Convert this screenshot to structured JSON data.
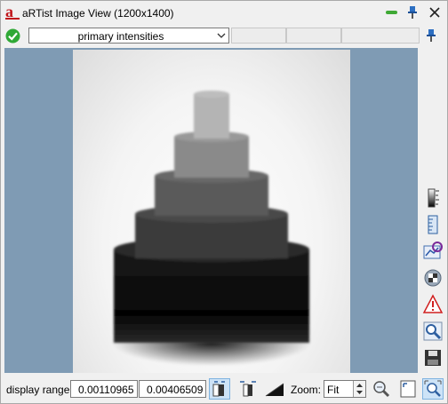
{
  "window": {
    "title": "aRTist Image View (1200x1400)",
    "logo_letter": "a"
  },
  "toolbar": {
    "channel_select": "primary intensities"
  },
  "status": {
    "display_range_label": "display range",
    "range_min": "0.00110965",
    "range_max": "0.00406509",
    "zoom_label": "Zoom:",
    "zoom_value": "Fit"
  },
  "sidebar": {
    "icons": [
      "colorbar-icon",
      "ruler-icon",
      "profile-icon",
      "checker-icon",
      "warning-icon",
      "magnify-icon",
      "save-icon"
    ]
  },
  "colors": {
    "view_background": "#7f9bb4",
    "accent_green": "#3fa935",
    "selected_bg": "#cde3f7"
  }
}
